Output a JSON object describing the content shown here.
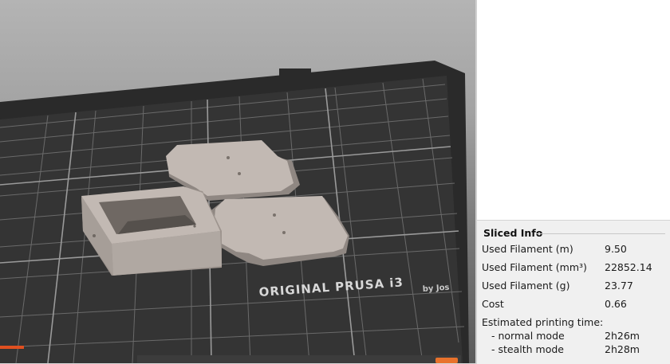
{
  "viewport": {
    "bed_label": "ORIGINAL PRUSA i3",
    "bed_sublabel": "by Jos"
  },
  "sliced_info": {
    "title": "Sliced Info",
    "rows": [
      {
        "label": "Used Filament (m)",
        "value": "9.50"
      },
      {
        "label": "Used Filament (mm³)",
        "value": "22852.14"
      },
      {
        "label": "Used Filament (g)",
        "value": "23.77"
      },
      {
        "label": "Cost",
        "value": "0.66"
      }
    ],
    "time_label": "Estimated printing time:",
    "modes": [
      {
        "label": "- normal mode",
        "value": "2h26m"
      },
      {
        "label": "- stealth mode",
        "value": "2h28m"
      }
    ]
  },
  "colors": {
    "bed": "#2e2e2e",
    "model": "#c2b9b3",
    "accent": "#e8722c"
  }
}
